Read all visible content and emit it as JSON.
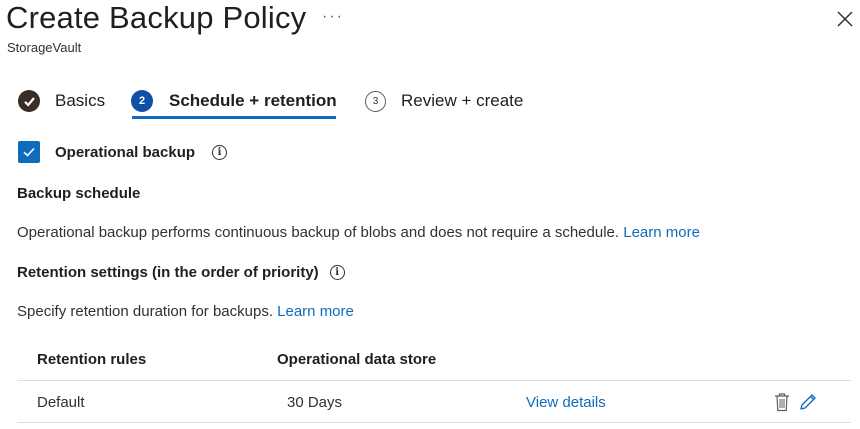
{
  "header": {
    "title": "Create Backup Policy",
    "more_label": "···",
    "subtitle": "StorageVault"
  },
  "steps": [
    {
      "number": "",
      "label": "Basics",
      "state": "completed"
    },
    {
      "number": "2",
      "label": "Schedule + retention",
      "state": "current"
    },
    {
      "number": "3",
      "label": "Review + create",
      "state": "upcoming"
    }
  ],
  "operational_backup": {
    "label": "Operational backup",
    "checked": true,
    "info_glyph": "i"
  },
  "backup_schedule": {
    "heading": "Backup schedule",
    "description": "Operational backup performs continuous backup of blobs and does not require a schedule.",
    "link": "Learn more"
  },
  "retention": {
    "heading": "Retention settings (in the order of priority)",
    "info_glyph": "i",
    "description": "Specify retention duration for backups.",
    "link": "Learn more"
  },
  "table": {
    "columns": [
      "Retention rules",
      "Operational data store"
    ],
    "rows": [
      {
        "rule": "Default",
        "store": "30 Days",
        "action": "View details"
      }
    ]
  },
  "colors": {
    "accent": "#0f6cbd",
    "completed": "#3b2c26",
    "text": "#201f1e"
  },
  "icons": [
    "more-icon",
    "close-icon",
    "checkmark-icon",
    "info-icon",
    "trash-icon",
    "pencil-icon"
  ]
}
